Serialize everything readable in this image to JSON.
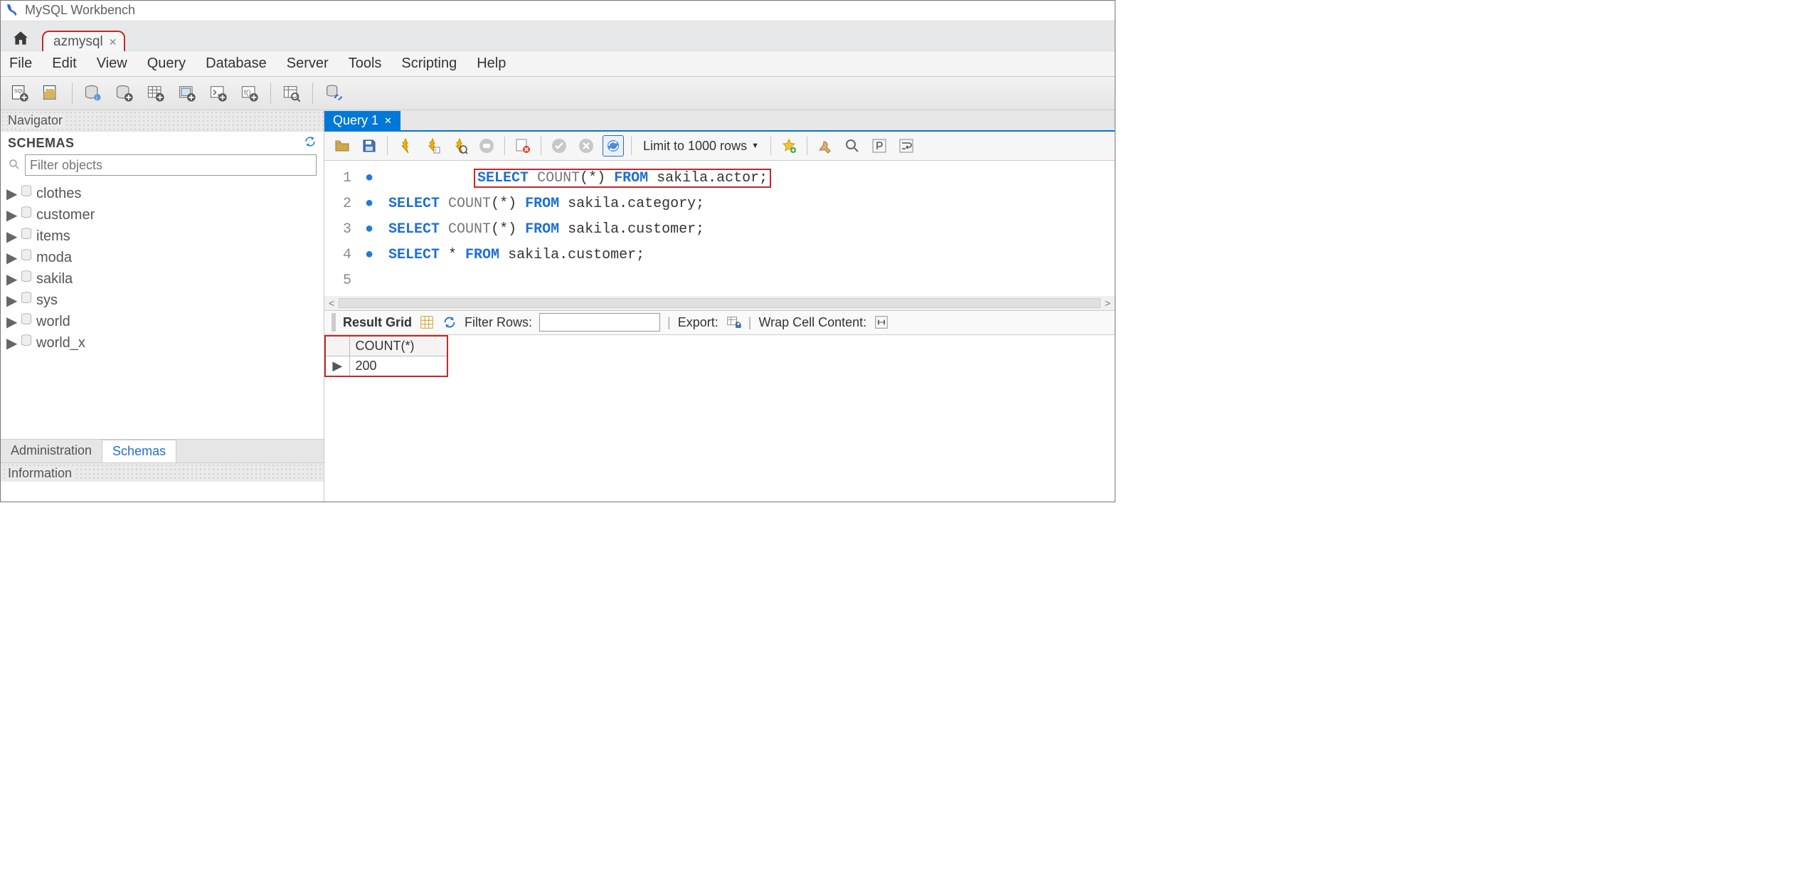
{
  "titlebar": {
    "title": "MySQL Workbench"
  },
  "connection_tab": {
    "label": "azmysql"
  },
  "menu": {
    "file": "File",
    "edit": "Edit",
    "view": "View",
    "query": "Query",
    "database": "Database",
    "server": "Server",
    "tools": "Tools",
    "scripting": "Scripting",
    "help": "Help"
  },
  "navigator": {
    "header": "Navigator"
  },
  "schemas": {
    "heading": "SCHEMAS",
    "filter_placeholder": "Filter objects",
    "items": [
      "clothes",
      "customer",
      "items",
      "moda",
      "sakila",
      "sys",
      "world",
      "world_x"
    ]
  },
  "nav_tabs": {
    "admin": "Administration",
    "schemas": "Schemas"
  },
  "information": {
    "header": "Information"
  },
  "query_tab": {
    "label": "Query 1"
  },
  "limit_rows": {
    "label": "Limit to 1000 rows"
  },
  "editor_lines": {
    "l1": {
      "n": "1",
      "kw1": "SELECT",
      "fn": "COUNT",
      "par": "(*)",
      "kw2": "FROM",
      "rest": " sakila.actor;"
    },
    "l2": {
      "n": "2",
      "kw1": "SELECT",
      "fn": "COUNT",
      "par": "(*)",
      "kw2": "FROM",
      "rest": " sakila.category;"
    },
    "l3": {
      "n": "3",
      "kw1": "SELECT",
      "fn": "COUNT",
      "par": "(*)",
      "kw2": "FROM",
      "rest": " sakila.customer;"
    },
    "l4": {
      "n": "4",
      "kw1": "SELECT",
      "star": " * ",
      "kw2": "FROM",
      "rest": " sakila.customer;"
    },
    "l5": {
      "n": "5"
    }
  },
  "result_bar": {
    "result_grid": "Result Grid",
    "filter_rows": "Filter Rows:",
    "export": "Export:",
    "wrap": "Wrap Cell Content:"
  },
  "result_table": {
    "col": "COUNT(*)",
    "row_indicator": "▶",
    "value": "200"
  }
}
